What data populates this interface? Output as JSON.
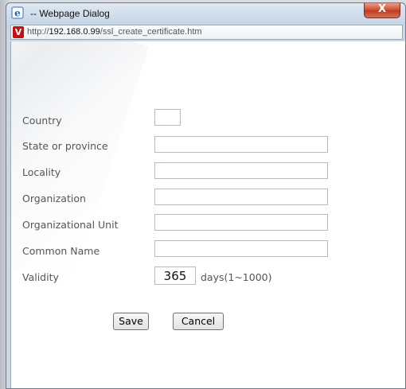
{
  "window": {
    "title": "-- Webpage Dialog",
    "close_label": "X"
  },
  "addressbar": {
    "url_prefix": "http://",
    "url_host": "192.168.0.99",
    "url_path": "/ssl_create_certificate.htm"
  },
  "form": {
    "country_label": "Country",
    "country_value": "",
    "state_label": "State or province",
    "state_value": "",
    "locality_label": "Locality",
    "locality_value": "",
    "organization_label": "Organization",
    "organization_value": "",
    "org_unit_label": "Organizational Unit",
    "org_unit_value": "",
    "common_name_label": "Common Name",
    "common_name_value": "",
    "validity_label": "Validity",
    "validity_value": "365",
    "validity_hint": "days(1~1000)"
  },
  "buttons": {
    "save_label": "Save",
    "cancel_label": "Cancel"
  }
}
